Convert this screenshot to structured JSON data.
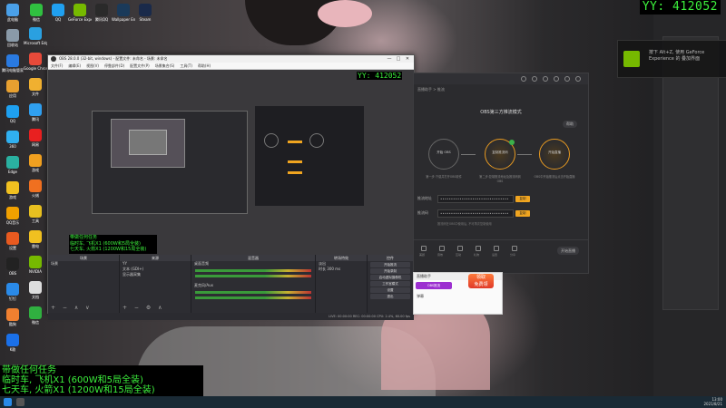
{
  "overlay": {
    "yy_id": "YY: 412052",
    "bottom_lines": [
      "带做任何任务",
      "临时车, 飞机X1 (600W和5局全装)",
      "七天车, 火箭X1 (1200W和15局全装)"
    ]
  },
  "notification": {
    "line1": "按下 Alt+Z, 使用 GeForce",
    "line2": "Experience 的 叠加界面"
  },
  "desktop": {
    "left_icons": [
      {
        "name": "此电脑",
        "color": "#4aa0e8",
        "icon": "computer-icon"
      },
      {
        "name": "回收站",
        "color": "#8a9aa8",
        "icon": "recycle-bin-icon"
      },
      {
        "name": "腾讯电脑管家",
        "color": "#2a7ae0",
        "icon": "shield-icon"
      },
      {
        "name": "应用",
        "color": "#e8a030",
        "icon": "app-icon"
      },
      {
        "name": "QQ",
        "color": "#1ea0f0",
        "icon": "qq-icon"
      },
      {
        "name": "360",
        "color": "#30b0f0",
        "icon": "browser-icon"
      },
      {
        "name": "Edge",
        "color": "#2ab0a0",
        "icon": "edge-icon"
      },
      {
        "name": "游戏",
        "color": "#f0c020",
        "icon": "game-icon"
      },
      {
        "name": "QQ音乐",
        "color": "#f0a000",
        "icon": "music-icon"
      },
      {
        "name": "设置",
        "color": "#e85a20",
        "icon": "settings-icon"
      },
      {
        "name": "OBS",
        "color": "#222",
        "icon": "obs-icon"
      },
      {
        "name": "钉钉",
        "color": "#2a8ae8",
        "icon": "chat-icon"
      },
      {
        "name": "酷狗",
        "color": "#f08030",
        "icon": "player-icon"
      },
      {
        "name": "K歌",
        "color": "#1a70e8",
        "icon": "karaoke-icon"
      }
    ],
    "second_icons": [
      {
        "name": "Microsoft Edge",
        "color": "#2aa0e0",
        "icon": "edge-icon"
      },
      {
        "name": "Google Chrome",
        "color": "#e84a3a",
        "icon": "chrome-icon"
      },
      {
        "name": "文件",
        "color": "#f0b030",
        "icon": "folder-icon"
      },
      {
        "name": "腾讯",
        "color": "#30a0f0",
        "icon": "qq-icon"
      },
      {
        "name": "网易",
        "color": "#e82020",
        "icon": "netease-icon"
      },
      {
        "name": "游戏",
        "color": "#f0a020",
        "icon": "game-icon"
      },
      {
        "name": "火绒",
        "color": "#f07020",
        "icon": "fire-icon"
      },
      {
        "name": "工具",
        "color": "#e8c020",
        "icon": "tool-icon"
      },
      {
        "name": "雷电",
        "color": "#f0c020",
        "icon": "thunder-icon"
      },
      {
        "name": "NVIDIA",
        "color": "#76b900",
        "icon": "nvidia-icon"
      },
      {
        "name": "文档",
        "color": "#ddd",
        "icon": "document-icon"
      },
      {
        "name": "微信",
        "color": "#30b040",
        "icon": "wechat-icon"
      }
    ],
    "top_icons": [
      {
        "name": "微信",
        "color": "#30c040",
        "icon": "wechat-icon"
      },
      {
        "name": "QQ",
        "color": "#20a0f0",
        "icon": "qq-icon"
      },
      {
        "name": "GeForce Experience",
        "color": "#76b900",
        "icon": "geforce-icon"
      },
      {
        "name": "腾讯QQ",
        "color": "#2a2a2a",
        "icon": "app-icon"
      },
      {
        "name": "Wallpaper Engine",
        "color": "#1a3a5a",
        "icon": "wallpaper-icon"
      },
      {
        "name": "Steam",
        "color": "#1a2a4a",
        "icon": "steam-icon"
      }
    ]
  },
  "obs": {
    "title": "OBS 28.0.0 (32-bit, windows) - 配置文件: 未命名 - 场景: 未命名",
    "menu": [
      "文件(F)",
      "编辑(E)",
      "视图(V)",
      "停靠部件(D)",
      "配置文件(P)",
      "场景集合(S)",
      "工具(T)",
      "帮助(H)"
    ],
    "preview_yy": "YY: 412052",
    "preview_text": [
      "带做任何任务",
      "临时车, 飞机X1 (600W和5局全装)",
      "七天车, 火箭X1 (1200W和15局全装)"
    ],
    "docks": {
      "scenes": {
        "header": "场景",
        "items": [
          "场景"
        ]
      },
      "sources": {
        "header": "来源",
        "items": [
          "YY",
          "文本 (GDI+)",
          "显示器采集"
        ]
      },
      "mixer": {
        "header": "混音器",
        "items": [
          "桌面音频",
          "麦克风/Aux"
        ]
      },
      "transitions": {
        "header": "转场特效",
        "items": [
          "淡出",
          "时长 300 ms"
        ]
      },
      "controls": {
        "header": "控件",
        "buttons": [
          "开始推流",
          "开始录制",
          "启动虚拟摄像机",
          "工作室模式",
          "设置",
          "退出"
        ]
      }
    },
    "status": "LIVE: 00:00:00   REC: 00:00:00   CPU: 2.4%, 60.00 fps"
  },
  "panel": {
    "crumbs": "直播助手 > 推流",
    "title": "OBS第三方推流模式",
    "help": "帮助",
    "steps": [
      {
        "label": "开始 OBS",
        "desc": "第一步:下载并打开OBS软件"
      },
      {
        "label": "复制推流码",
        "desc": "第二步:复制推流地址及推流码到OBS"
      },
      {
        "label": "开始直播",
        "desc": "OBS中开始推流后点击开始直播"
      }
    ],
    "rows": [
      {
        "label": "推流地址",
        "value": "••••••••••••••••••••••••••••••••",
        "button": "复制"
      },
      {
        "label": "推流码",
        "value": "••••••••••••••••••••••••••••••••",
        "button": "复制"
      }
    ],
    "hint": "推流码在OBS中使用后, 不可再次复制使用",
    "bottom_labels": [
      "美颜",
      "音效",
      "互动",
      "礼物",
      "设置",
      "分享"
    ],
    "start_button": "开始直播"
  },
  "popup": {
    "header": "直播助手",
    "button": "OBS推流",
    "text": "弹幕"
  },
  "badge": {
    "line1": "领取",
    "line2": "免费领"
  },
  "taskbar": {
    "time": "13:00",
    "date": "2021/8/21"
  }
}
